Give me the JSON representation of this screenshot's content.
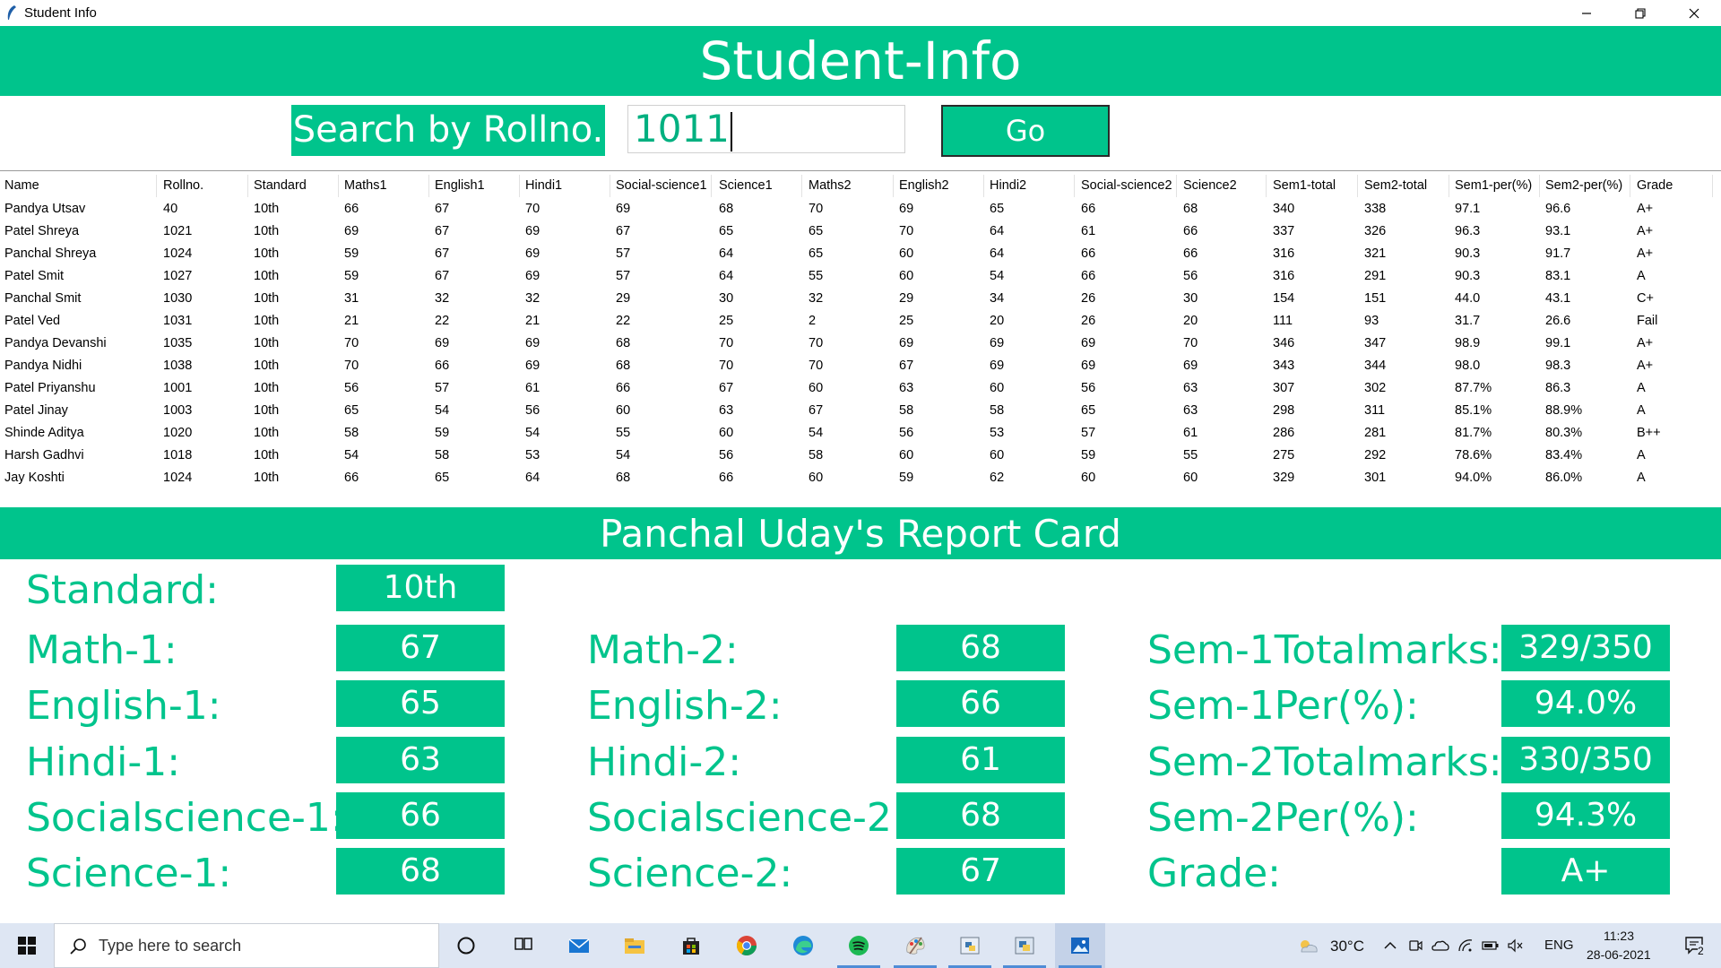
{
  "window": {
    "title": "Student Info"
  },
  "header": {
    "title": "Student-Info"
  },
  "search": {
    "label": "Search by Rollno.",
    "value": "1011",
    "button": "Go"
  },
  "table": {
    "columns": [
      "Name",
      "Rollno.",
      "Standard",
      "Maths1",
      "English1",
      "Hindi1",
      "Social-science1",
      "Science1",
      "Maths2",
      "English2",
      "Hindi2",
      "Social-science2",
      "Science2",
      "Sem1-total",
      "Sem2-total",
      "Sem1-per(%)",
      "Sem2-per(%)",
      "Grade"
    ],
    "rows": [
      [
        "Pandya Utsav",
        "40",
        "10th",
        "66",
        "67",
        "70",
        "69",
        "68",
        "70",
        "69",
        "65",
        "66",
        "68",
        "340",
        "338",
        "97.1",
        "96.6",
        "A+"
      ],
      [
        "Patel Shreya",
        "1021",
        "10th",
        "69",
        "67",
        "69",
        "67",
        "65",
        "65",
        "70",
        "64",
        "61",
        "66",
        "337",
        "326",
        "96.3",
        "93.1",
        "A+"
      ],
      [
        "Panchal Shreya",
        "1024",
        "10th",
        "59",
        "67",
        "69",
        "57",
        "64",
        "65",
        "60",
        "64",
        "66",
        "66",
        "316",
        "321",
        "90.3",
        "91.7",
        "A+"
      ],
      [
        "Patel Smit",
        "1027",
        "10th",
        "59",
        "67",
        "69",
        "57",
        "64",
        "55",
        "60",
        "54",
        "66",
        "56",
        "316",
        "291",
        "90.3",
        "83.1",
        "A"
      ],
      [
        "Panchal Smit",
        "1030",
        "10th",
        "31",
        "32",
        "32",
        "29",
        "30",
        "32",
        "29",
        "34",
        "26",
        "30",
        "154",
        "151",
        "44.0",
        "43.1",
        "C+"
      ],
      [
        "Patel Ved",
        "1031",
        "10th",
        "21",
        "22",
        "21",
        "22",
        "25",
        "2",
        "25",
        "20",
        "26",
        "20",
        "111",
        "93",
        "31.7",
        "26.6",
        "Fail"
      ],
      [
        "Pandya Devanshi",
        "1035",
        "10th",
        "70",
        "69",
        "69",
        "68",
        "70",
        "70",
        "69",
        "69",
        "69",
        "70",
        "346",
        "347",
        "98.9",
        "99.1",
        "A+"
      ],
      [
        "Pandya Nidhi",
        "1038",
        "10th",
        "70",
        "66",
        "69",
        "68",
        "70",
        "70",
        "67",
        "69",
        "69",
        "69",
        "343",
        "344",
        "98.0",
        "98.3",
        "A+"
      ],
      [
        "Patel Priyanshu",
        "1001",
        "10th",
        "56",
        "57",
        "61",
        "66",
        "67",
        "60",
        "63",
        "60",
        "56",
        "63",
        "307",
        "302",
        "87.7%",
        "86.3",
        "A"
      ],
      [
        "Patel Jinay",
        "1003",
        "10th",
        "65",
        "54",
        "56",
        "60",
        "63",
        "67",
        "58",
        "58",
        "65",
        "63",
        "298",
        "311",
        "85.1%",
        "88.9%",
        "A"
      ],
      [
        "Shinde Aditya",
        "1020",
        "10th",
        "58",
        "59",
        "54",
        "55",
        "60",
        "54",
        "56",
        "53",
        "57",
        "61",
        "286",
        "281",
        "81.7%",
        "80.3%",
        "B++"
      ],
      [
        "Harsh Gadhvi",
        "1018",
        "10th",
        "54",
        "58",
        "53",
        "54",
        "56",
        "58",
        "60",
        "60",
        "59",
        "55",
        "275",
        "292",
        "78.6%",
        "83.4%",
        "A"
      ],
      [
        "Jay Koshti",
        "1024",
        "10th",
        "66",
        "65",
        "64",
        "68",
        "66",
        "60",
        "59",
        "62",
        "60",
        "60",
        "329",
        "301",
        "94.0%",
        "86.0%",
        "A"
      ]
    ]
  },
  "report": {
    "title": "Panchal Uday's Report Card",
    "standard_label": "Standard:",
    "standard": "10th",
    "col1": [
      {
        "label": "Math-1:",
        "value": "67"
      },
      {
        "label": "English-1:",
        "value": "65"
      },
      {
        "label": "Hindi-1:",
        "value": "63"
      },
      {
        "label": "Socialscience-1:",
        "value": "66"
      },
      {
        "label": "Science-1:",
        "value": "68"
      }
    ],
    "col2": [
      {
        "label": "Math-2:",
        "value": "68"
      },
      {
        "label": "English-2:",
        "value": "66"
      },
      {
        "label": "Hindi-2:",
        "value": "61"
      },
      {
        "label": "Socialscience-2:",
        "value": "68"
      },
      {
        "label": "Science-2:",
        "value": "67"
      }
    ],
    "col3": [
      {
        "label": "Sem-1Totalmarks:",
        "value": "329/350"
      },
      {
        "label": "Sem-1Per(%):",
        "value": "94.0%"
      },
      {
        "label": "Sem-2Totalmarks:",
        "value": "330/350"
      },
      {
        "label": "Sem-2Per(%):",
        "value": "94.3%"
      },
      {
        "label": "Grade:",
        "value": "A+"
      }
    ]
  },
  "taskbar": {
    "search_placeholder": "Type here to search",
    "weather": "30°C",
    "lang": "ENG",
    "time": "11:23",
    "date": "28-06-2021",
    "notification_count": "2",
    "pinned_icons": [
      "task-view-icon",
      "mail-icon",
      "file-explorer-icon",
      "store-icon",
      "chrome-icon",
      "edge-icon",
      "spotify-icon",
      "paint-icon",
      "python-idle-icon",
      "python-app-icon",
      "photos-icon"
    ]
  },
  "colors": {
    "accent": "#00c48c",
    "white": "#ffffff",
    "taskbar": "#dee6f3"
  }
}
